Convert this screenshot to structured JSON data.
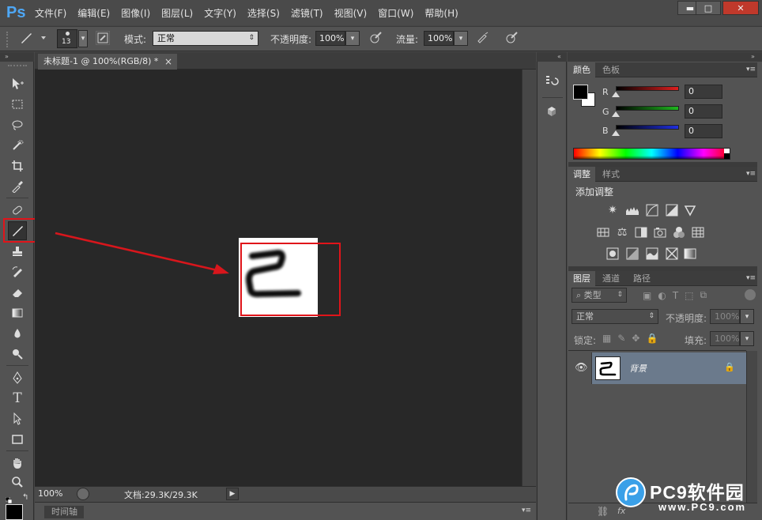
{
  "app": {
    "logo": "Ps"
  },
  "menu": {
    "items": [
      "文件(F)",
      "编辑(E)",
      "图像(I)",
      "图层(L)",
      "文字(Y)",
      "选择(S)",
      "滤镜(T)",
      "视图(V)",
      "窗口(W)",
      "帮助(H)"
    ]
  },
  "window_controls": {
    "minimize": "▬",
    "maximize": "□",
    "close": "✕"
  },
  "options": {
    "brush_size": "13",
    "mode_label": "模式:",
    "mode_value": "正常",
    "opacity_label": "不透明度:",
    "opacity_value": "100%",
    "flow_label": "流量:",
    "flow_value": "100%"
  },
  "document": {
    "tab_title": "未标题-1 @ 100%(RGB/8) *",
    "tab_close": "×",
    "zoom": "100%",
    "doc_info": "文档:29.3K/29.3K",
    "timeline_label": "时间轴"
  },
  "color_panel": {
    "tabs": [
      "颜色",
      "色板"
    ],
    "channels": [
      {
        "label": "R",
        "value": "0",
        "color": "#e01f1f"
      },
      {
        "label": "G",
        "value": "0",
        "color": "#1fb71f"
      },
      {
        "label": "B",
        "value": "0",
        "color": "#1f2fe0"
      }
    ]
  },
  "adjust_panel": {
    "tabs": [
      "调整",
      "样式"
    ],
    "title": "添加调整"
  },
  "layers_panel": {
    "tabs": [
      "图层",
      "通道",
      "路径"
    ],
    "filter_value": "类型",
    "blend_value": "正常",
    "opacity_label": "不透明度:",
    "opacity_value": "100%",
    "lock_label": "锁定:",
    "fill_label": "填充:",
    "fill_value": "100%",
    "layer_name": "背景"
  },
  "watermark": {
    "brand": "PC9软件园",
    "url": "www.PC9.com"
  }
}
